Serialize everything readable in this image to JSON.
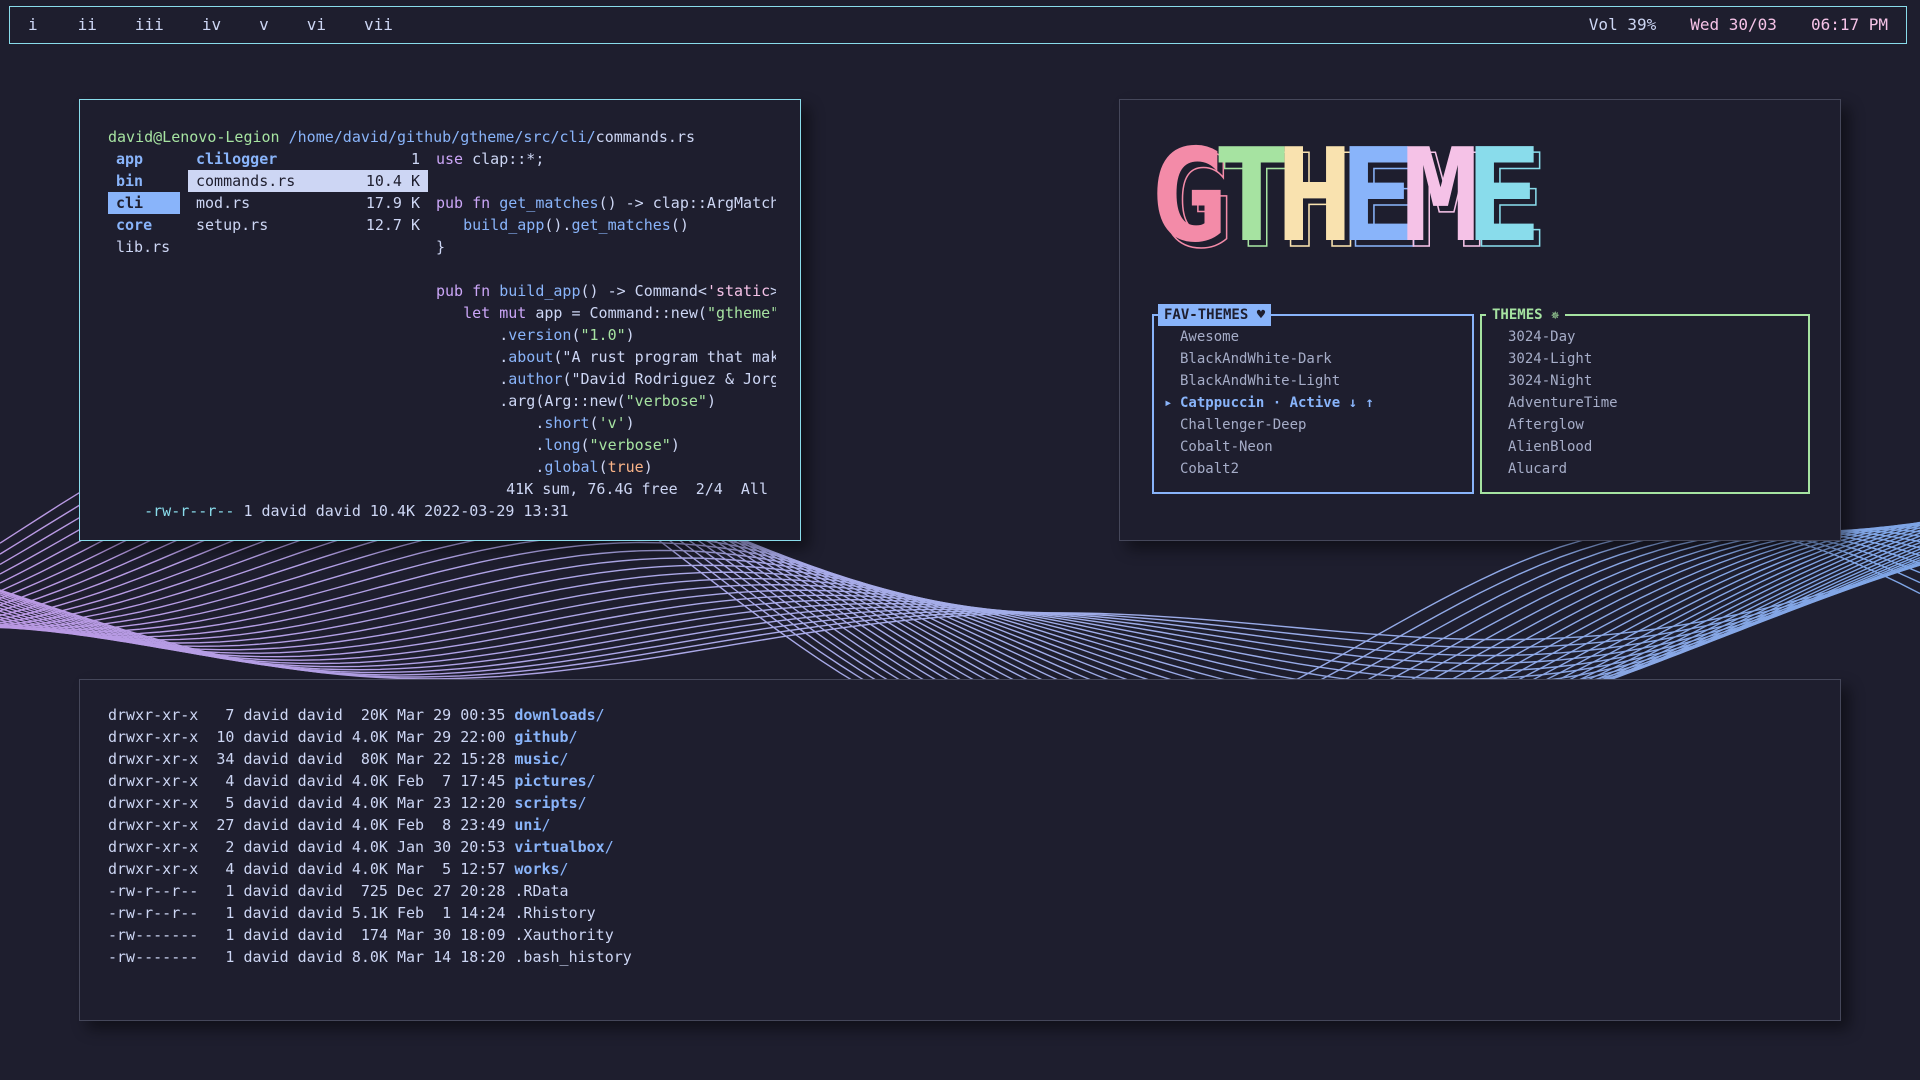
{
  "bar": {
    "workspaces": [
      "i",
      "ii",
      "iii",
      "iv",
      "v",
      "vi",
      "vii"
    ],
    "volume": "Vol 39%",
    "date": "Wed 30/03",
    "time": "06:17 PM"
  },
  "ranger": {
    "user": "david@Lenovo-Legion",
    "path": "/home/david/github/gtheme/src/cli/",
    "file": "commands.rs",
    "parent_items": [
      "app",
      "bin",
      "cli",
      "core",
      "lib.rs"
    ],
    "selected_parent": "cli",
    "current_items": [
      {
        "name": "clilogger",
        "size": "1"
      },
      {
        "name": "commands.rs",
        "size": "10.4 K"
      },
      {
        "name": "mod.rs",
        "size": "17.9 K"
      },
      {
        "name": "setup.rs",
        "size": "12.7 K"
      }
    ],
    "selected_current": "commands.rs",
    "code": [
      "use clap::*;",
      "",
      "pub fn get_matches() -> clap::ArgMatches {",
      "   build_app().get_matches()",
      "}",
      "",
      "pub fn build_app() -> Command<'static> {",
      "   let mut app = Command::new(\"gtheme\")",
      "       .version(\"1.0\")",
      "       .about(\"A rust program that makes y",
      "       .author(\"David Rodriguez & Jorge He",
      "       .arg(Arg::new(\"verbose\")",
      "           .short('v')",
      "           .long(\"verbose\")",
      "           .global(true)"
    ],
    "footer_perm": "-rw-r--r--",
    "footer_info": " 1 david david 10.4K 2022-03-29 13:31",
    "footer_right": "41K sum, 76.4G free  2/4  All"
  },
  "gtheme": {
    "logo": "GTHEME",
    "logo_colors": [
      "#f38ba8",
      "#a6e3a1",
      "#f9e2af",
      "#89b4fa",
      "#f5c2e7",
      "#89dceb"
    ],
    "fav_title": "FAV-THEMES ♥",
    "fav_items": [
      "Awesome",
      "BlackAndWhite-Dark",
      "BlackAndWhite-Light",
      "Catppuccin · Active ↓ ↑",
      "Challenger-Deep",
      "Cobalt-Neon",
      "Cobalt2"
    ],
    "fav_active_index": 3,
    "themes_title": "THEMES ✵",
    "themes_items": [
      "3024-Day",
      "3024-Light",
      "3024-Night",
      "AdventureTime",
      "Afterglow",
      "AlienBlood",
      "Alucard"
    ]
  },
  "ls": {
    "rows": [
      {
        "meta": "drwxr-xr-x   7 david david  20K Mar 29 00:35 ",
        "name": "downloads",
        "suffix": "/",
        "dir": true
      },
      {
        "meta": "drwxr-xr-x  10 david david 4.0K Mar 29 22:00 ",
        "name": "github",
        "suffix": "/",
        "dir": true
      },
      {
        "meta": "drwxr-xr-x  34 david david  80K Mar 22 15:28 ",
        "name": "music",
        "suffix": "/",
        "dir": true
      },
      {
        "meta": "drwxr-xr-x   4 david david 4.0K Feb  7 17:45 ",
        "name": "pictures",
        "suffix": "/",
        "dir": true
      },
      {
        "meta": "drwxr-xr-x   5 david david 4.0K Mar 23 12:20 ",
        "name": "scripts",
        "suffix": "/",
        "dir": true
      },
      {
        "meta": "drwxr-xr-x  27 david david 4.0K Feb  8 23:49 ",
        "name": "uni",
        "suffix": "/",
        "dir": true
      },
      {
        "meta": "drwxr-xr-x   2 david david 4.0K Jan 30 20:53 ",
        "name": "virtualbox",
        "suffix": "/",
        "dir": true
      },
      {
        "meta": "drwxr-xr-x   4 david david 4.0K Mar  5 12:57 ",
        "name": "works",
        "suffix": "/",
        "dir": true
      },
      {
        "meta": "-rw-r--r--   1 david david  725 Dec 27 20:28 ",
        "name": ".RData",
        "suffix": "",
        "dir": false
      },
      {
        "meta": "-rw-r--r--   1 david david 5.1K Feb  1 14:24 ",
        "name": ".Rhistory",
        "suffix": "",
        "dir": false
      },
      {
        "meta": "-rw-------   1 david david  174 Mar 30 18:09 ",
        "name": ".Xauthority",
        "suffix": "",
        "dir": false
      },
      {
        "meta": "-rw-------   1 david david 8.0K Mar 14 18:20 ",
        "name": ".bash_history",
        "suffix": "",
        "dir": false
      }
    ]
  }
}
